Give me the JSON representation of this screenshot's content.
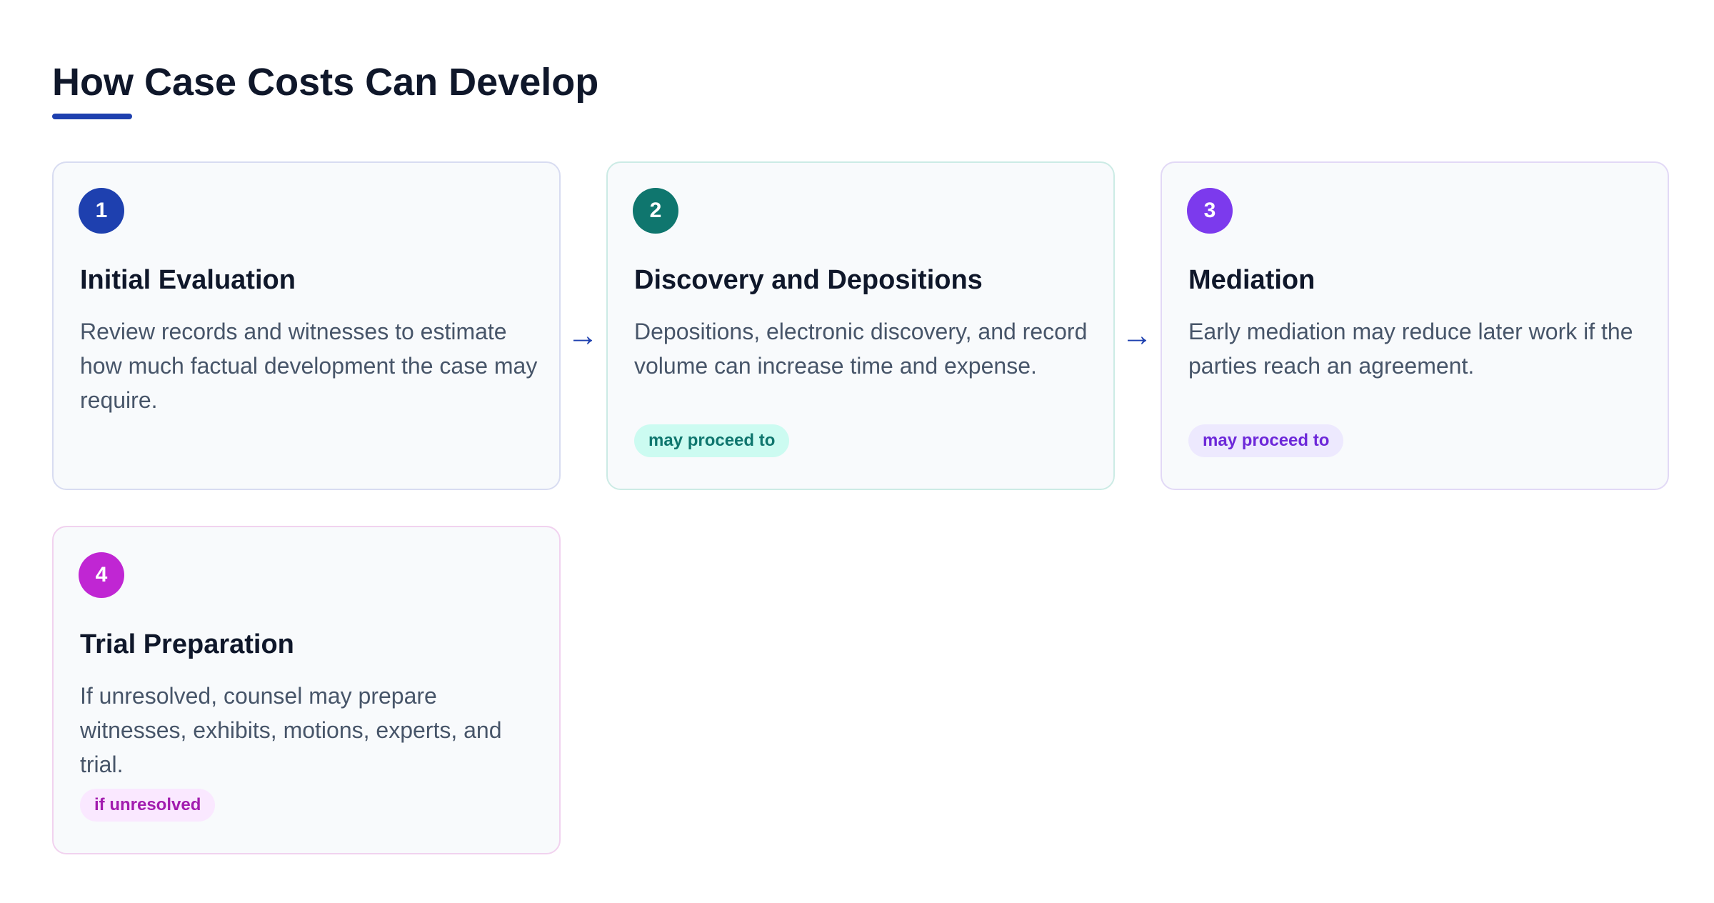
{
  "header": {
    "title": "How Case Costs Can Develop"
  },
  "colors": {
    "accent": "#1e40af",
    "step_1": "#1e40af",
    "step_2": "#0f766e",
    "step_3": "#7c3aed",
    "step_4": "#c026d3"
  },
  "steps": [
    {
      "number": "1",
      "title": "Initial Evaluation",
      "description": "Review records and witnesses to estimate how much factual development the case may require.",
      "tag": ""
    },
    {
      "number": "2",
      "title": "Discovery and Depositions",
      "description": "Depositions, electronic discovery, and record volume can increase time and expense.",
      "tag": "may proceed to",
      "tag_bg": "#ccfbf1",
      "tag_color": "#0f766e"
    },
    {
      "number": "3",
      "title": "Mediation",
      "description": "Early mediation may reduce later work if the parties reach an agreement.",
      "tag": "may proceed to",
      "tag_bg": "#ede9fe",
      "tag_color": "#6d28d9"
    },
    {
      "number": "4",
      "title": "Trial Preparation",
      "description": "If unresolved, counsel may prepare witnesses, exhibits, motions, experts, and trial.",
      "tag": "if unresolved",
      "tag_bg": "#fae8ff",
      "tag_color": "#a21caf"
    }
  ],
  "connectors": {
    "arrow_1": "→",
    "arrow_2": "→"
  }
}
